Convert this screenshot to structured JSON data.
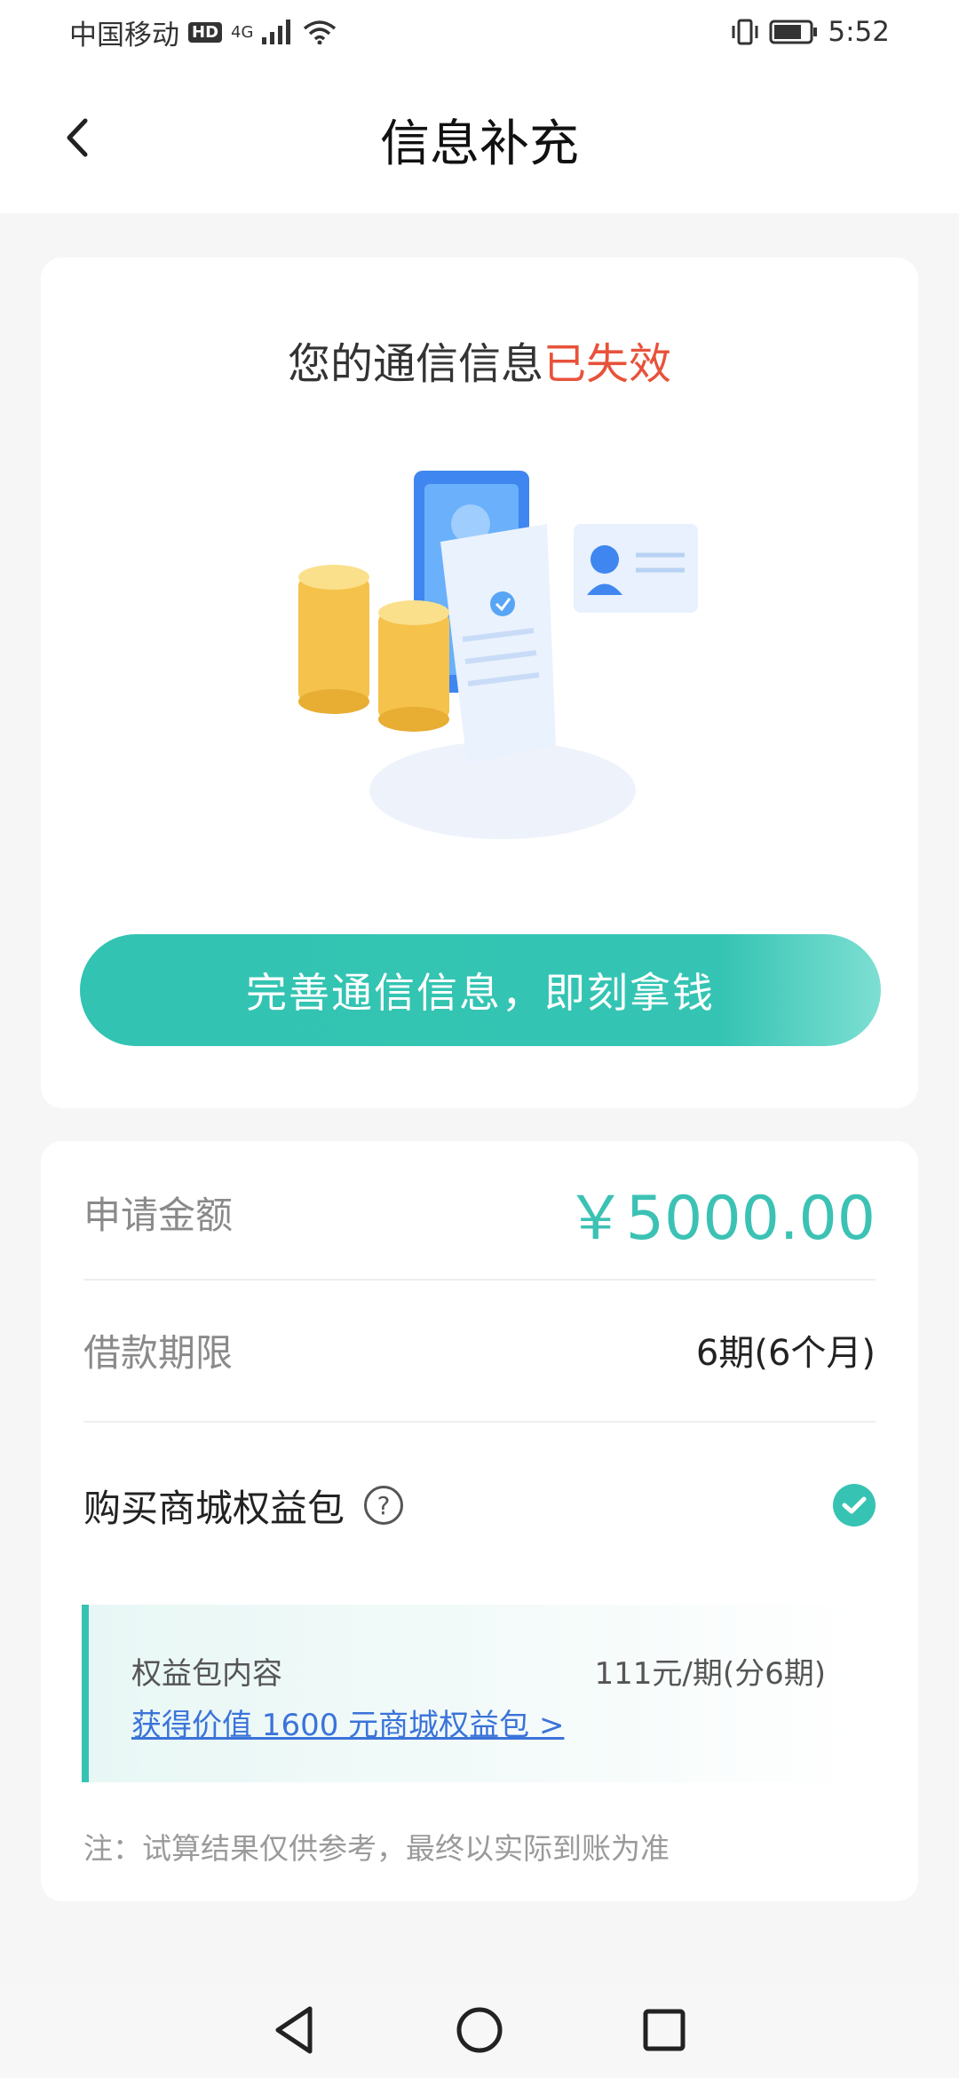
{
  "status_bar": {
    "carrier": "中国移动",
    "hd": "HD",
    "network": "4G",
    "time": "5:52",
    "icons": [
      "signal-icon",
      "wifi-icon",
      "vibrate-icon",
      "battery-icon"
    ]
  },
  "nav": {
    "title": "信息补充",
    "back_icon": "chevron-left-icon"
  },
  "notice": {
    "prefix": "您的通信信息",
    "status": "已失效"
  },
  "primary_button": {
    "label": "完善通信信息，即刻拿钱"
  },
  "loan": {
    "amount_label": "申请金额",
    "amount_value": "￥5000.00",
    "term_label": "借款期限",
    "term_value": "6期(6个月)"
  },
  "package": {
    "label": "购买商城权益包",
    "help_icon": "question-icon",
    "checked": true,
    "content_title": "权益包内容",
    "price": "111元/期(分6期)",
    "link_text": "获得价值 1600 元商城权益包 >"
  },
  "note": "注：试算结果仅供参考，最终以实际到账为准",
  "colors": {
    "accent": "#36c3b3",
    "alert": "#e8523b",
    "link": "#3b73d9"
  }
}
